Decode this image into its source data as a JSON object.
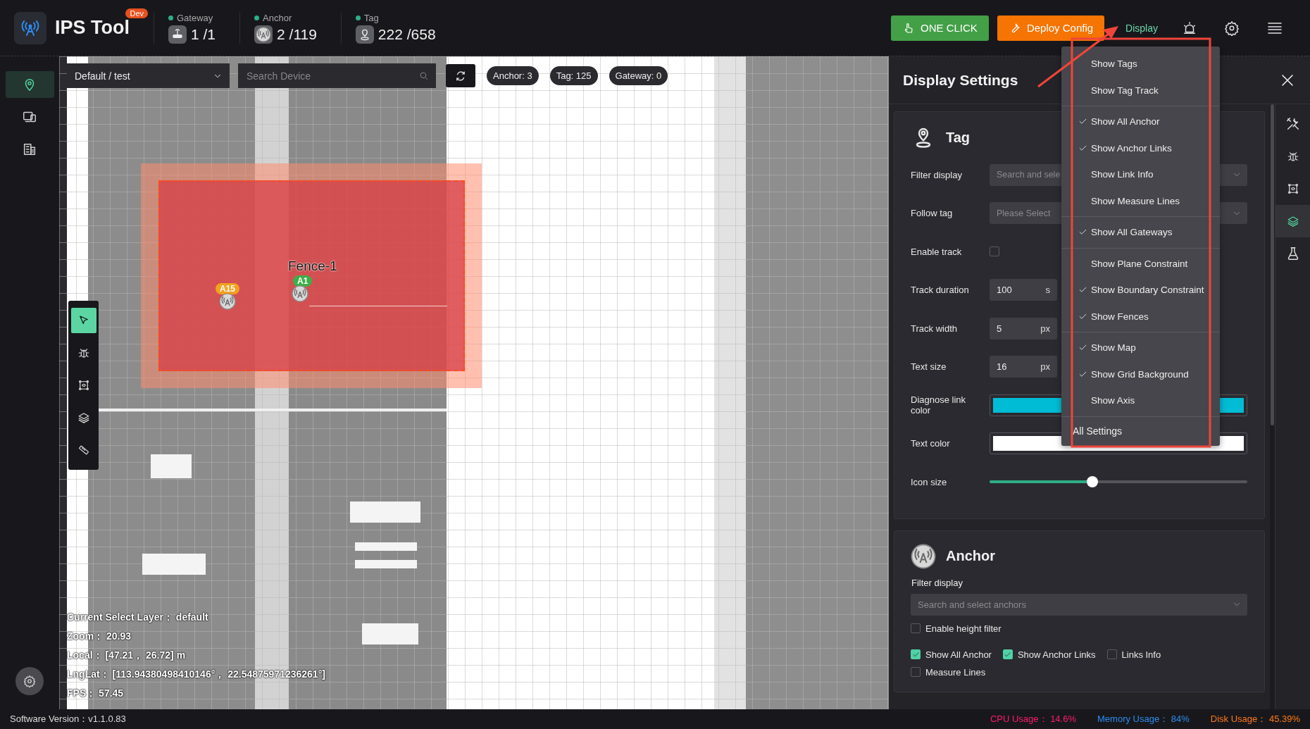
{
  "app": {
    "title": "IPS Tool",
    "badge": "Dev"
  },
  "stats": [
    {
      "kind": "gateway",
      "label": "Gateway",
      "value": "1 /1"
    },
    {
      "kind": "anchor",
      "label": "Anchor",
      "value": "2 /119"
    },
    {
      "kind": "tag",
      "label": "Tag",
      "value": "222 /658"
    }
  ],
  "actions": [
    {
      "kind": "one-click",
      "label": "ONE CLICK"
    },
    {
      "kind": "deploy",
      "label": "Deploy Config"
    }
  ],
  "display_link": "Display",
  "sidebar": {
    "items": [
      {
        "kind": "map",
        "selected": true
      },
      {
        "kind": "devices",
        "selected": false
      },
      {
        "kind": "building",
        "selected": false
      }
    ]
  },
  "map": {
    "layer_select": "Default / test",
    "search": {
      "placeholder": "Search Device"
    },
    "counts": [
      "Anchor: 3",
      "Tag: 125",
      "Gateway: 0"
    ],
    "tools": [
      {
        "kind": "pointer",
        "selected": true
      },
      {
        "kind": "bug",
        "selected": false
      },
      {
        "kind": "frame",
        "selected": false
      },
      {
        "kind": "layers",
        "selected": false
      },
      {
        "kind": "ruler",
        "selected": false
      }
    ],
    "fence": {
      "label": "Fence-1"
    },
    "anchors": [
      {
        "label": "A15",
        "color": "#f5a01e"
      },
      {
        "label": "A1",
        "color": "#3fae49"
      }
    ],
    "info": [
      "Current Select Layer：  default",
      "Zoom：  20.93",
      "Local：  [47.21，  26.72] m",
      "LngLat：  [113.94380498410146°，  22.54875971236261°]",
      "FPS：  57.45"
    ]
  },
  "panel": {
    "title": "Display Settings",
    "tag": {
      "title": "Tag",
      "rows": [
        {
          "kind": "select",
          "label": "Filter display",
          "placeholder": "Search and sele"
        },
        {
          "kind": "select",
          "label": "Follow tag",
          "placeholder": "Please Select"
        },
        {
          "kind": "checkbox",
          "label": "Enable track",
          "checked": false
        },
        {
          "kind": "number",
          "label": "Track duration",
          "value": "100",
          "unit": "s"
        },
        {
          "kind": "number",
          "label": "Track width",
          "value": "5",
          "unit": "px"
        },
        {
          "kind": "number",
          "label": "Text size",
          "value": "16",
          "unit": "px"
        },
        {
          "kind": "color",
          "label": "Diagnose link color",
          "color": "#00bcd4"
        },
        {
          "kind": "color",
          "label": "Text color",
          "color": "#ffffff"
        },
        {
          "kind": "slider",
          "label": "Icon size",
          "level": 0.4
        }
      ]
    },
    "anchor": {
      "title": "Anchor",
      "filter_label": "Filter display",
      "filter": {
        "placeholder": "Search and select anchors"
      },
      "height_filter": {
        "label": "Enable height filter",
        "checked": false
      },
      "options": [
        {
          "label": "Show All Anchor",
          "checked": true
        },
        {
          "label": "Show Anchor Links",
          "checked": true
        },
        {
          "label": "Links Info",
          "checked": false
        },
        {
          "label": "Measure Lines",
          "checked": false
        }
      ]
    }
  },
  "rail": [
    {
      "kind": "tools",
      "selected": false
    },
    {
      "kind": "bug",
      "selected": false
    },
    {
      "kind": "frame",
      "selected": false
    },
    {
      "kind": "layers",
      "selected": true
    },
    {
      "kind": "flask",
      "selected": false
    }
  ],
  "menu": {
    "groups": [
      [
        {
          "label": "Show Tags",
          "checked": false
        },
        {
          "label": "Show Tag Track",
          "checked": false
        }
      ],
      [
        {
          "label": "Show All Anchor",
          "checked": true
        },
        {
          "label": "Show Anchor Links",
          "checked": true
        },
        {
          "label": "Show Link Info",
          "checked": false
        },
        {
          "label": "Show Measure Lines",
          "checked": false
        }
      ],
      [
        {
          "label": "Show All Gateways",
          "checked": true
        }
      ],
      [
        {
          "label": "Show Plane Constraint",
          "checked": false
        },
        {
          "label": "Show Boundary Constraint",
          "checked": true
        },
        {
          "label": "Show Fences",
          "checked": true
        }
      ],
      [
        {
          "label": "Show Map",
          "checked": true
        },
        {
          "label": "Show Grid Background",
          "checked": true
        },
        {
          "label": "Show Axis",
          "checked": false
        }
      ]
    ],
    "footer": "All Settings"
  },
  "status": {
    "version": "Software Version：v1.1.0.83",
    "metrics": [
      {
        "label": "CPU Usage：",
        "value": "14.6%",
        "color": "#ff1a6e"
      },
      {
        "label": "Memory Usage：",
        "value": "84%",
        "color": "#2d8cf0"
      },
      {
        "label": "Disk Usage：",
        "value": "45.39%",
        "color": "#ff7a14"
      }
    ]
  }
}
